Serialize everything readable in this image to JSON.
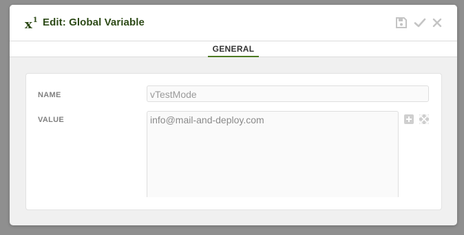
{
  "dialog": {
    "title": "Edit: Global Variable",
    "icon": "variable-x-icon",
    "actions": [
      "save-icon",
      "check-icon",
      "close-icon"
    ]
  },
  "tabs": [
    {
      "label": "GENERAL",
      "active": true
    }
  ],
  "form": {
    "name_label": "NAME",
    "name_value": "vTestMode",
    "value_label": "VALUE",
    "value_value": "info@mail-and-deploy.com"
  },
  "colors": {
    "title": "#2d4a17",
    "tab_underline": "#4c7a22",
    "icon_gray": "#c4c4c4",
    "overlay": "#8f8f8f"
  }
}
